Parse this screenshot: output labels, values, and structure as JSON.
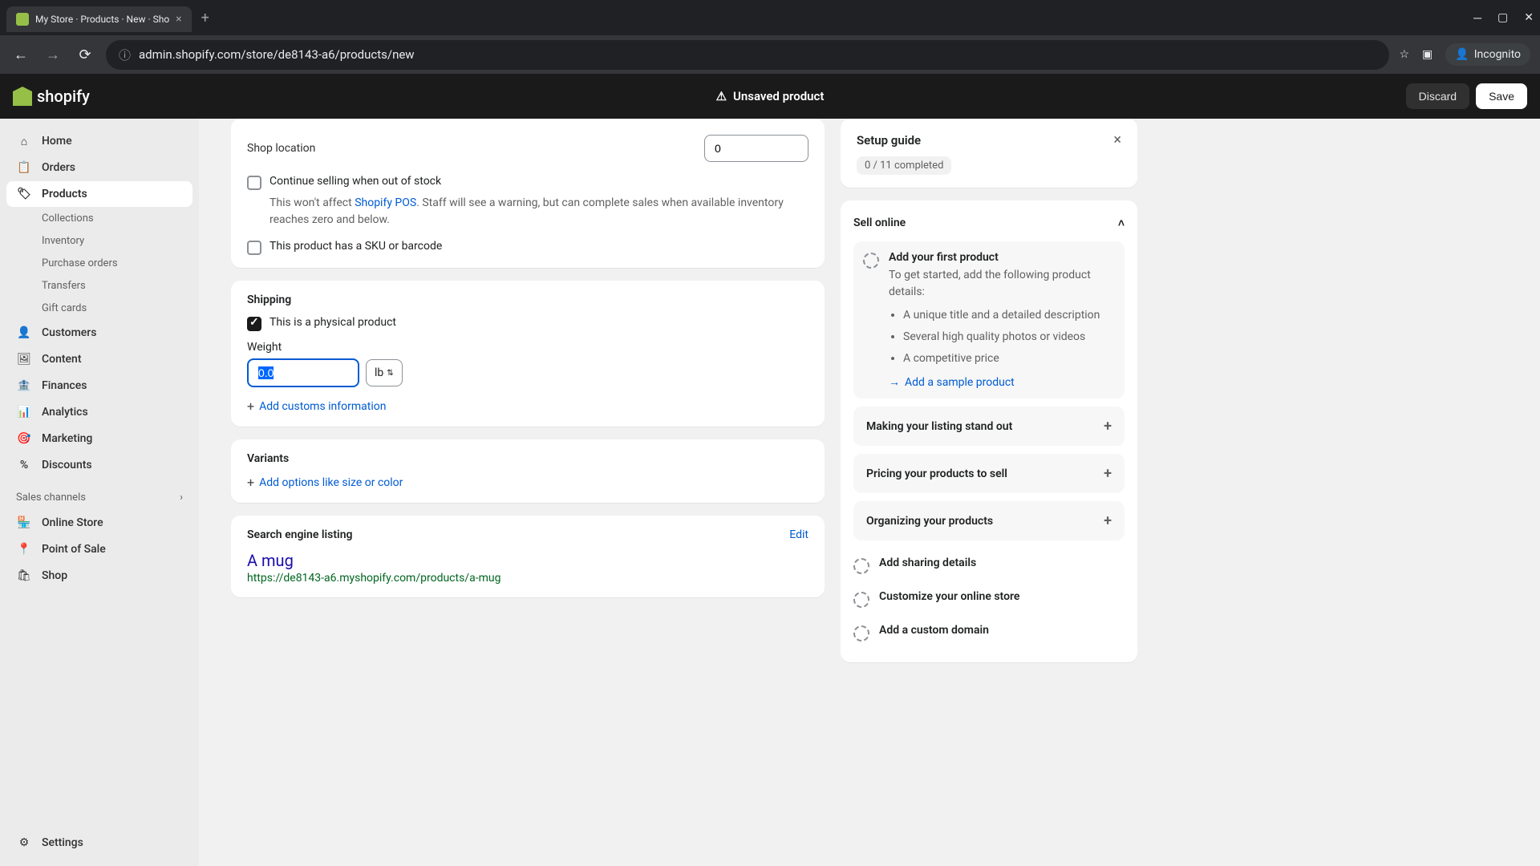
{
  "browser": {
    "tab_title": "My Store · Products · New · Sho",
    "url": "admin.shopify.com/store/de8143-a6/products/new",
    "incognito_label": "Incognito"
  },
  "topbar": {
    "brand": "shopify",
    "unsaved_label": "Unsaved product",
    "discard_label": "Discard",
    "save_label": "Save"
  },
  "sidebar": {
    "items": [
      {
        "label": "Home",
        "icon": "home"
      },
      {
        "label": "Orders",
        "icon": "orders"
      },
      {
        "label": "Products",
        "icon": "products",
        "active": true
      },
      {
        "label": "Collections",
        "sub": true
      },
      {
        "label": "Inventory",
        "sub": true
      },
      {
        "label": "Purchase orders",
        "sub": true
      },
      {
        "label": "Transfers",
        "sub": true
      },
      {
        "label": "Gift cards",
        "sub": true
      },
      {
        "label": "Customers",
        "icon": "customers"
      },
      {
        "label": "Content",
        "icon": "content"
      },
      {
        "label": "Finances",
        "icon": "finances"
      },
      {
        "label": "Analytics",
        "icon": "analytics"
      },
      {
        "label": "Marketing",
        "icon": "marketing"
      },
      {
        "label": "Discounts",
        "icon": "discounts"
      }
    ],
    "sales_channels_label": "Sales channels",
    "channels": [
      {
        "label": "Online Store"
      },
      {
        "label": "Point of Sale"
      },
      {
        "label": "Shop"
      }
    ],
    "settings_label": "Settings"
  },
  "inventory": {
    "shop_location_label": "Shop location",
    "shop_location_value": "0",
    "continue_selling_label": "Continue selling when out of stock",
    "continue_selling_help_pre": "This won't affect ",
    "continue_selling_help_link": "Shopify POS",
    "continue_selling_help_post": ". Staff will see a warning, but can complete sales when available inventory reaches zero and below.",
    "sku_label": "This product has a SKU or barcode"
  },
  "shipping": {
    "title": "Shipping",
    "physical_label": "This is a physical product",
    "physical_checked": true,
    "weight_label": "Weight",
    "weight_value": "0.0",
    "weight_unit": "lb",
    "customs_label": "Add customs information"
  },
  "variants": {
    "title": "Variants",
    "add_options_label": "Add options like size or color"
  },
  "seo": {
    "title": "Search engine listing",
    "edit_label": "Edit",
    "page_title": "A mug",
    "page_url": "https://de8143-a6.myshopify.com/products/a-mug"
  },
  "setup": {
    "title": "Setup guide",
    "progress": "0 / 11 completed",
    "section_title": "Sell online",
    "first_product": {
      "title": "Add your first product",
      "desc": "To get started, add the following product details:",
      "bullets": [
        "A unique title and a detailed description",
        "Several high quality photos or videos",
        "A competitive price"
      ],
      "sample_link": "Add a sample product"
    },
    "collapsed": [
      "Making your listing stand out",
      "Pricing your products to sell",
      "Organizing your products"
    ],
    "other_steps": [
      "Add sharing details",
      "Customize your online store",
      "Add a custom domain"
    ]
  }
}
